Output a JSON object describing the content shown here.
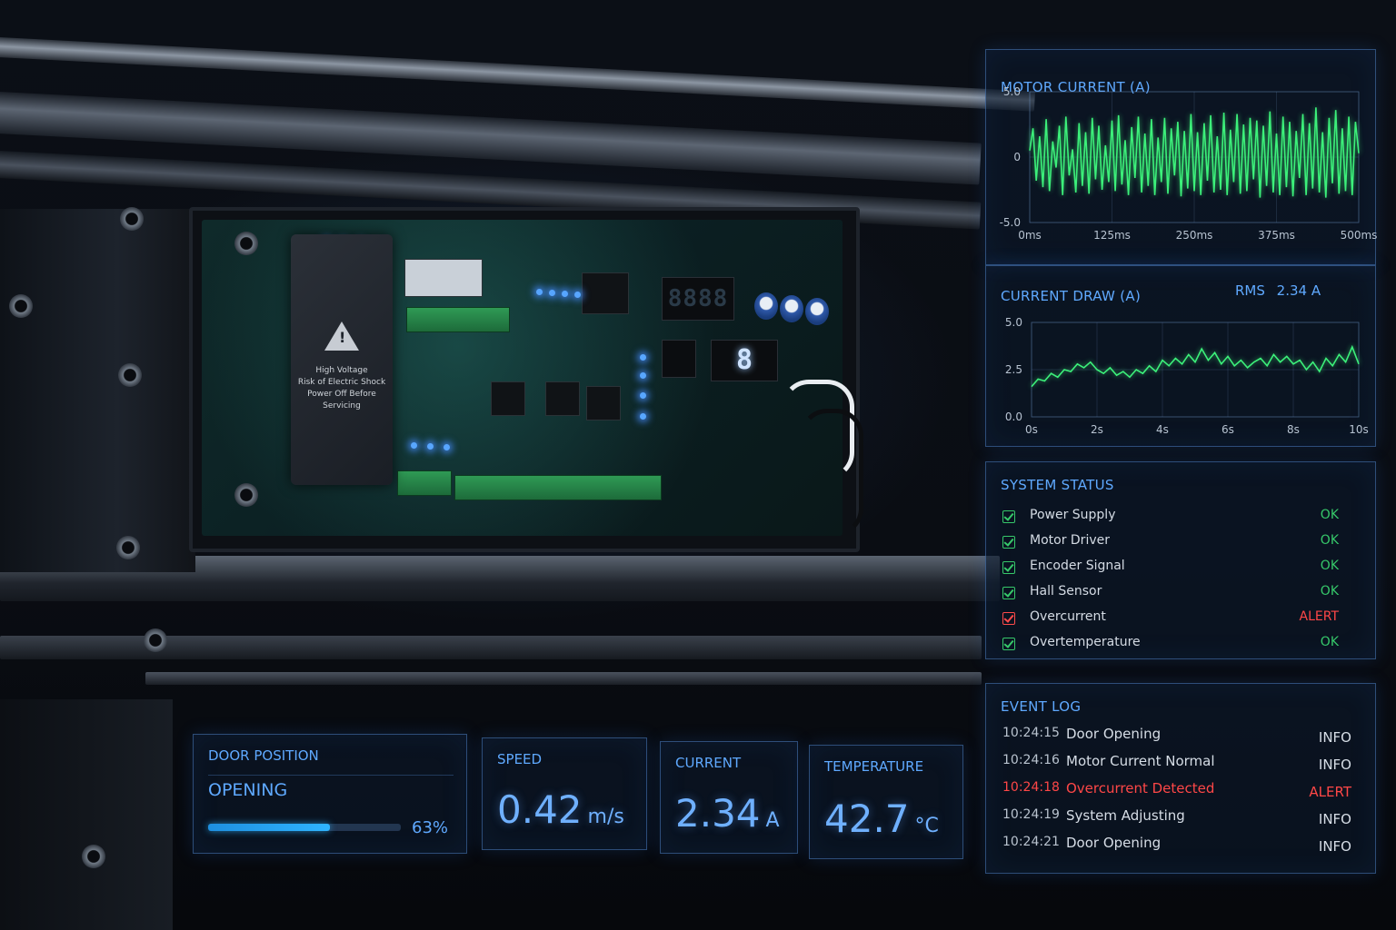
{
  "device": {
    "warning_text": [
      "High Voltage",
      "Risk of Electric Shock",
      "Power Off Before",
      "Servicing"
    ],
    "seven_segment_digits": "8888"
  },
  "panels": {
    "motor_current": {
      "title": "MOTOR CURRENT (A)"
    },
    "current_draw": {
      "title": "CURRENT DRAW (A)",
      "rms_label": "RMS",
      "rms_value": "2.34 A"
    },
    "system_status": {
      "title": "SYSTEM STATUS",
      "items": [
        {
          "label": "Power Supply",
          "status": "OK",
          "state": "ok"
        },
        {
          "label": "Motor Driver",
          "status": "OK",
          "state": "ok"
        },
        {
          "label": "Encoder Signal",
          "status": "OK",
          "state": "ok"
        },
        {
          "label": "Hall Sensor",
          "status": "OK",
          "state": "ok"
        },
        {
          "label": "Overcurrent",
          "status": "ALERT",
          "state": "alert"
        },
        {
          "label": "Overtemperature",
          "status": "OK",
          "state": "ok"
        }
      ]
    },
    "event_log": {
      "title": "EVENT LOG",
      "entries": [
        {
          "time": "10:24:15",
          "message": "Door Opening",
          "level": "INFO",
          "state": "info"
        },
        {
          "time": "10:24:16",
          "message": "Motor Current Normal",
          "level": "INFO",
          "state": "info"
        },
        {
          "time": "10:24:18",
          "message": "Overcurrent Detected",
          "level": "ALERT",
          "state": "alert"
        },
        {
          "time": "10:24:19",
          "message": "System Adjusting",
          "level": "INFO",
          "state": "info"
        },
        {
          "time": "10:24:21",
          "message": "Door Opening",
          "level": "INFO",
          "state": "info"
        }
      ]
    },
    "door_position": {
      "title": "DOOR POSITION",
      "state": "OPENING",
      "progress_percent": 63,
      "progress_label": "63%"
    },
    "speed": {
      "title": "SPEED",
      "value": "0.42",
      "unit": "m/s"
    },
    "current": {
      "title": "CURRENT",
      "value": "2.34",
      "unit": "A"
    },
    "temperature": {
      "title": "TEMPERATURE",
      "value": "42.7",
      "unit": "°C"
    }
  },
  "colors": {
    "accent": "#5fa9ff",
    "ok": "#36c86a",
    "alert": "#ff4747",
    "trace": "#3cf07a"
  },
  "chart_data": [
    {
      "type": "line",
      "title": "MOTOR CURRENT (A)",
      "x_tick_labels": [
        "0ms",
        "125ms",
        "250ms",
        "375ms",
        "500ms"
      ],
      "y_tick_labels": [
        "5.0",
        "0",
        "-5.0"
      ],
      "xlim": [
        0,
        500
      ],
      "ylim": [
        -5,
        5
      ],
      "grid": true,
      "series": [
        {
          "x": [
            0,
            5,
            10,
            15,
            20,
            25,
            30,
            35,
            40,
            45,
            50,
            55,
            60,
            65,
            70,
            75,
            80,
            85,
            90,
            95,
            100,
            105,
            110,
            115,
            120,
            125,
            130,
            135,
            140,
            145,
            150,
            155,
            160,
            165,
            170,
            175,
            180,
            185,
            190,
            195,
            200,
            205,
            210,
            215,
            220,
            225,
            230,
            235,
            240,
            245,
            250,
            255,
            260,
            265,
            270,
            275,
            280,
            285,
            290,
            295,
            300,
            305,
            310,
            315,
            320,
            325,
            330,
            335,
            340,
            345,
            350,
            355,
            360,
            365,
            370,
            375,
            380,
            385,
            390,
            395,
            400,
            405,
            410,
            415,
            420,
            425,
            430,
            435,
            440,
            445,
            450,
            455,
            460,
            465,
            470,
            475,
            480,
            485,
            490,
            495,
            500
          ],
          "y": [
            0.5,
            2.2,
            -1.8,
            1.6,
            -2.3,
            2.9,
            -2.6,
            1.2,
            -0.8,
            2.4,
            -2.9,
            3.1,
            -1.4,
            0.6,
            -2.7,
            2.6,
            -2.2,
            1.9,
            -2.8,
            3.0,
            -1.7,
            2.4,
            -2.5,
            0.9,
            -1.9,
            2.8,
            -2.6,
            3.2,
            -2.1,
            1.3,
            -2.9,
            2.3,
            -1.6,
            3.1,
            -2.7,
            1.8,
            -2.2,
            2.9,
            -2.9,
            1.5,
            -1.9,
            3.0,
            -2.8,
            2.2,
            -1.4,
            2.7,
            -3.0,
            2.0,
            -2.4,
            3.3,
            -2.6,
            1.9,
            -2.9,
            2.6,
            -1.8,
            3.2,
            -2.7,
            1.6,
            -2.5,
            3.4,
            -2.9,
            2.1,
            -1.9,
            3.3,
            -2.8,
            2.5,
            -2.6,
            3.0,
            -1.7,
            2.8,
            -3.1,
            2.4,
            -2.2,
            3.5,
            -2.7,
            1.8,
            -2.9,
            3.1,
            -2.3,
            2.7,
            -3.0,
            2.0,
            -1.6,
            3.3,
            -2.9,
            2.6,
            -2.4,
            3.8,
            -2.7,
            1.9,
            -3.1,
            3.0,
            -2.0,
            3.6,
            -2.8,
            2.2,
            -2.6,
            3.1,
            -2.9,
            2.7,
            0.3
          ]
        }
      ]
    },
    {
      "type": "line",
      "title": "CURRENT DRAW (A)",
      "x_tick_labels": [
        "0s",
        "2s",
        "4s",
        "6s",
        "8s",
        "10s"
      ],
      "y_tick_labels": [
        "5.0",
        "2.5",
        "0.0"
      ],
      "xlim": [
        0,
        10
      ],
      "ylim": [
        0,
        5
      ],
      "grid": true,
      "series": [
        {
          "x": [
            0,
            0.2,
            0.4,
            0.6,
            0.8,
            1.0,
            1.2,
            1.4,
            1.6,
            1.8,
            2.0,
            2.2,
            2.4,
            2.6,
            2.8,
            3.0,
            3.2,
            3.4,
            3.6,
            3.8,
            4.0,
            4.2,
            4.4,
            4.6,
            4.8,
            5.0,
            5.2,
            5.4,
            5.6,
            5.8,
            6.0,
            6.2,
            6.4,
            6.6,
            6.8,
            7.0,
            7.2,
            7.4,
            7.6,
            7.8,
            8.0,
            8.2,
            8.4,
            8.6,
            8.8,
            9.0,
            9.2,
            9.4,
            9.6,
            9.8,
            10.0
          ],
          "y": [
            1.6,
            2.0,
            1.9,
            2.3,
            2.1,
            2.5,
            2.4,
            2.8,
            2.6,
            2.9,
            2.5,
            2.3,
            2.6,
            2.2,
            2.4,
            2.1,
            2.5,
            2.3,
            2.7,
            2.4,
            3.0,
            2.7,
            3.1,
            2.8,
            3.3,
            2.9,
            3.6,
            3.0,
            3.4,
            2.8,
            3.2,
            2.7,
            3.0,
            2.6,
            2.9,
            3.1,
            2.7,
            3.3,
            2.9,
            3.2,
            2.8,
            3.0,
            2.5,
            2.9,
            2.4,
            3.1,
            2.7,
            3.3,
            2.9,
            3.7,
            2.8
          ]
        }
      ]
    }
  ]
}
